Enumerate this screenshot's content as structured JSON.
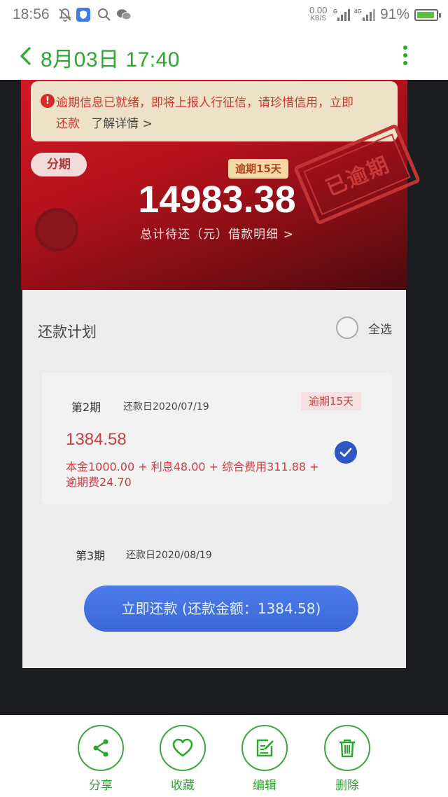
{
  "status_bar": {
    "time": "18:56",
    "net_speed_value": "0.00",
    "net_speed_unit": "KB/S",
    "network_type": "4G",
    "battery_percent": "91%",
    "battery_level": 0.91
  },
  "header": {
    "title": "8月03日 17:40"
  },
  "photo": {
    "notice_text": "逾期信息已就绪，即将上报人行征信，请珍惜信用，立即",
    "notice_pay": "还款",
    "notice_link": "了解详情 >",
    "tag_fenqi": "分期",
    "overdue_badge": "逾期15天",
    "stamp": "已逾期",
    "total_amount": "14983.38",
    "total_label": "总计待还（元）借款明细 >",
    "plan_title": "还款计划",
    "select_all": "全选",
    "periods": [
      {
        "no": "第2期",
        "date": "还款日2020/07/19",
        "badge": "逾期15天",
        "amount": "1384.58",
        "detail": "本金1000.00 + 利息48.00 + 综合费用311.88 + 逾期费24.70"
      },
      {
        "no": "第3期",
        "date": "还款日2020/08/19"
      }
    ],
    "pay_button": "立即还款 (还款金额：1384.58)"
  },
  "actions": [
    {
      "label": "分享",
      "icon": "share-icon"
    },
    {
      "label": "收藏",
      "icon": "heart-icon"
    },
    {
      "label": "编辑",
      "icon": "edit-icon"
    },
    {
      "label": "删除",
      "icon": "trash-icon"
    }
  ],
  "colors": {
    "accent_green": "#2aa82e",
    "alert_red": "#cc3d44",
    "button_blue": "#3a68d8"
  }
}
